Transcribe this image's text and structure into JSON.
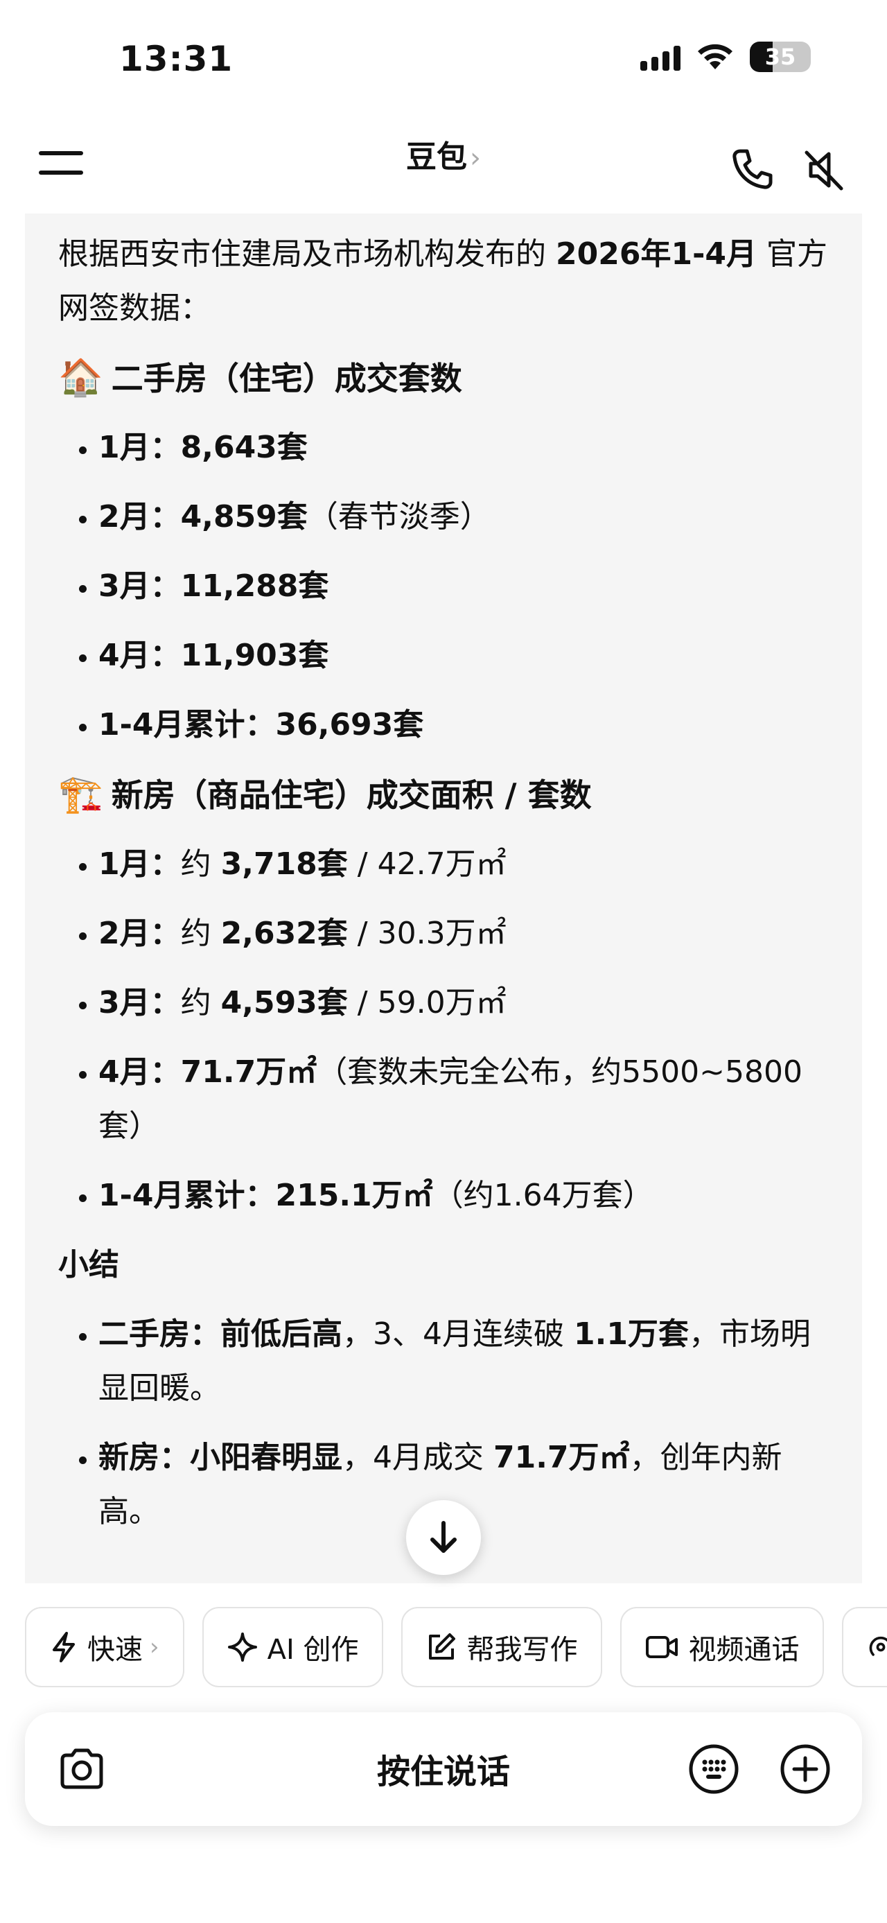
{
  "status": {
    "time": "13:31",
    "battery": "35"
  },
  "header": {
    "title": "豆包",
    "chevron": "›"
  },
  "message": {
    "intro_prefix": "根据西安市住建局及市场机构发布的 ",
    "intro_bold": "2026年1-4月",
    "intro_suffix": " 官方网签数据：",
    "section1": {
      "emoji": "🏠",
      "title": "二手房（住宅）成交套数"
    },
    "secondhand": [
      {
        "label": "1月：",
        "value": "8,643套",
        "note": ""
      },
      {
        "label": "2月：",
        "value": "4,859套",
        "note": "（春节淡季）"
      },
      {
        "label": "3月：",
        "value": "11,288套",
        "note": ""
      },
      {
        "label": "4月：",
        "value": "11,903套",
        "note": ""
      },
      {
        "label": "1-4月累计：",
        "value": "36,693套",
        "note": ""
      }
    ],
    "section2": {
      "emoji": "🏗️",
      "title": "新房（商品住宅）成交面积 / 套数"
    },
    "newhouse": [
      {
        "label": "1月：",
        "pre": "约 ",
        "value": "3,718套",
        "note": " / 42.7万㎡"
      },
      {
        "label": "2月：",
        "pre": "约 ",
        "value": "2,632套",
        "note": " / 30.3万㎡"
      },
      {
        "label": "3月：",
        "pre": "约 ",
        "value": "4,593套",
        "note": " / 59.0万㎡"
      },
      {
        "label": "4月：",
        "pre": "",
        "value": "71.7万㎡",
        "note": "（套数未完全公布，约5500~5800套）"
      },
      {
        "label": "1-4月累计：",
        "pre": "",
        "value": "215.1万㎡",
        "note": "（约1.64万套）"
      }
    ],
    "summary_title": "小结",
    "summary": [
      {
        "label": "二手房：",
        "bold": "前低后高",
        "text1": "，3、4月连续破 ",
        "bold2": "1.1万套",
        "text2": "，市场明显回暖。"
      },
      {
        "label": "新房：",
        "bold": "小阳春明显",
        "text1": "，4月成交 ",
        "bold2": "71.7万㎡",
        "text2": "，创年内新高。"
      }
    ]
  },
  "chips": [
    {
      "icon": "lightning-icon",
      "label": "快速",
      "chevron": "›"
    },
    {
      "icon": "sparkle-icon",
      "label": "AI 创作",
      "chevron": ""
    },
    {
      "icon": "edit-icon",
      "label": "帮我写作",
      "chevron": ""
    },
    {
      "icon": "video-icon",
      "label": "视频通话",
      "chevron": ""
    }
  ],
  "input": {
    "hold_to_talk": "按住说话"
  }
}
